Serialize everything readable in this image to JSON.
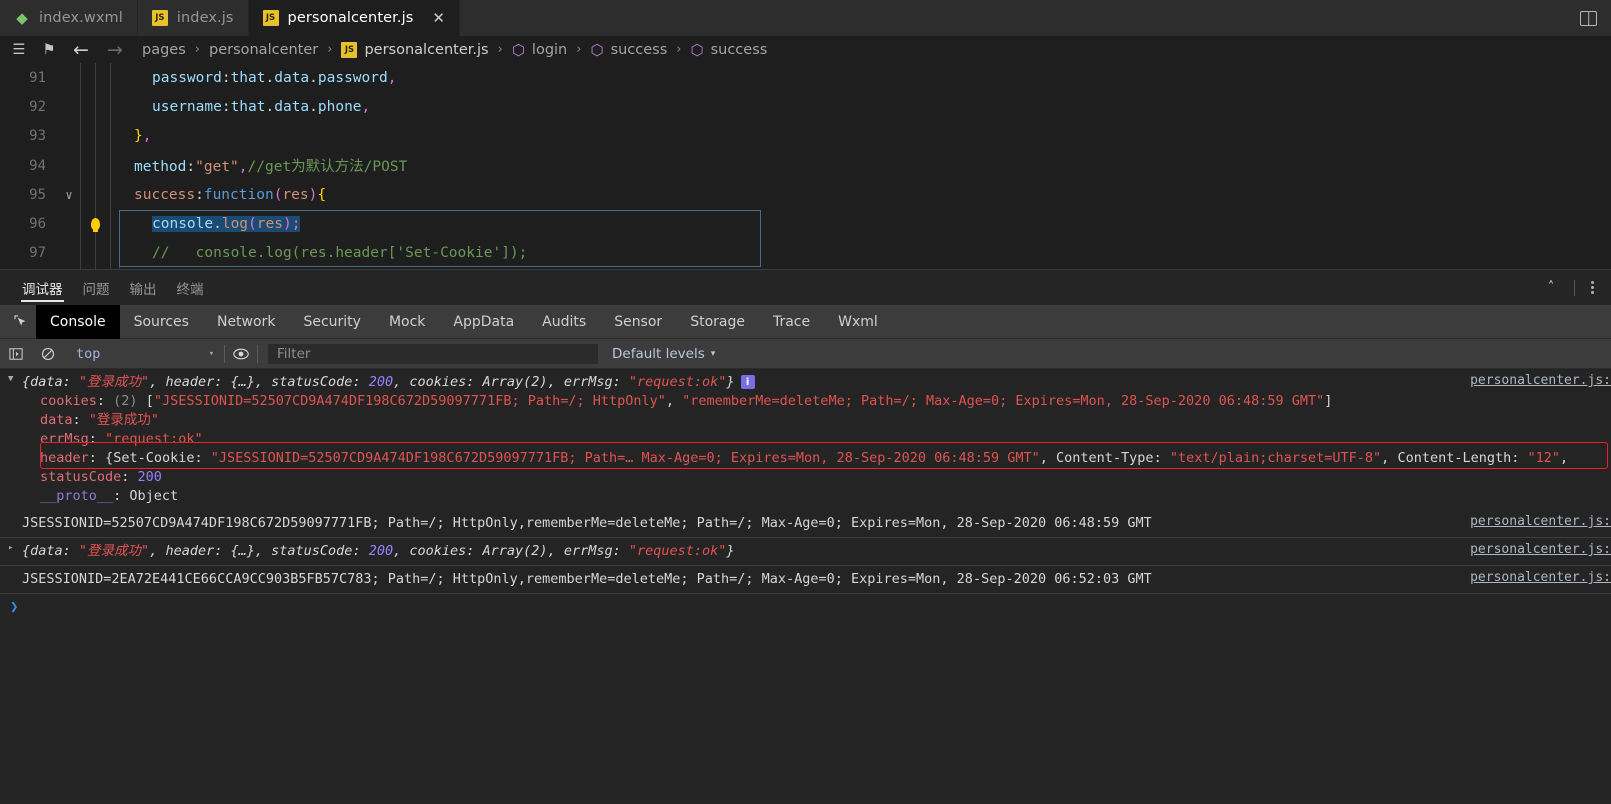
{
  "tabs": [
    {
      "label": "index.wxml",
      "icon": "wxml-file-icon",
      "icon_text": "◈",
      "active": false,
      "closable": false
    },
    {
      "label": "index.js",
      "icon": "js-file-icon",
      "icon_text": "JS",
      "active": false,
      "closable": false
    },
    {
      "label": "personalcenter.js",
      "icon": "js-file-icon",
      "icon_text": "JS",
      "active": true,
      "closable": true,
      "close_label": "✕"
    }
  ],
  "tabbar": {
    "split_editor_label": "split-editor"
  },
  "breadcrumb": {
    "menu_icon": "☰",
    "bookmark_icon": "⚑",
    "back_icon": "←",
    "forward_icon": "→",
    "segments": [
      {
        "text": "pages",
        "type": "folder"
      },
      {
        "text": "personalcenter",
        "type": "folder"
      },
      {
        "text": "personalcenter.js",
        "type": "file",
        "icon_text": "JS"
      },
      {
        "text": "login",
        "type": "symbol",
        "icon_text": "⬡"
      },
      {
        "text": "success",
        "type": "symbol",
        "icon_text": "⬡"
      },
      {
        "text": "success",
        "type": "symbol",
        "icon_text": "⬡"
      }
    ],
    "separator": "›"
  },
  "editor": {
    "lines": [
      {
        "no": "91",
        "folded": "",
        "bulb": false,
        "indent": 4,
        "tokens": [
          {
            "t": "password",
            "c": "k-prop"
          },
          {
            "t": ":",
            "c": "k-id"
          },
          {
            "t": "that",
            "c": "k-var"
          },
          {
            "t": ".",
            "c": "k-id"
          },
          {
            "t": "data",
            "c": "k-var"
          },
          {
            "t": ".",
            "c": "k-id"
          },
          {
            "t": "password",
            "c": "k-var"
          },
          {
            "t": ",",
            "c": "k-paren"
          }
        ]
      },
      {
        "no": "92",
        "folded": "",
        "bulb": false,
        "indent": 4,
        "tokens": [
          {
            "t": "username",
            "c": "k-prop"
          },
          {
            "t": ":",
            "c": "k-id"
          },
          {
            "t": "that",
            "c": "k-var"
          },
          {
            "t": ".",
            "c": "k-id"
          },
          {
            "t": "data",
            "c": "k-var"
          },
          {
            "t": ".",
            "c": "k-id"
          },
          {
            "t": "phone",
            "c": "k-var"
          },
          {
            "t": ",",
            "c": "k-paren"
          }
        ]
      },
      {
        "no": "93",
        "folded": "",
        "bulb": false,
        "indent": 2,
        "tokens": [
          {
            "t": "}",
            "c": "k-brace"
          },
          {
            "t": ",",
            "c": "k-paren"
          }
        ]
      },
      {
        "no": "94",
        "folded": "",
        "bulb": false,
        "indent": 2,
        "tokens": [
          {
            "t": "method",
            "c": "k-prop"
          },
          {
            "t": ":",
            "c": "k-id"
          },
          {
            "t": "\"get\"",
            "c": "k-str"
          },
          {
            "t": ",",
            "c": "k-paren"
          },
          {
            "t": "//get为默认方法/POST",
            "c": "k-cmt"
          }
        ]
      },
      {
        "no": "95",
        "folded": "∨",
        "bulb": false,
        "indent": 2,
        "tokens": [
          {
            "t": "success",
            "c": "k-orange"
          },
          {
            "t": ":",
            "c": "k-id"
          },
          {
            "t": "function",
            "c": "k-kw"
          },
          {
            "t": "(",
            "c": "k-paren"
          },
          {
            "t": "res",
            "c": "k-orange"
          },
          {
            "t": ")",
            "c": "k-paren"
          },
          {
            "t": "{",
            "c": "k-brace"
          }
        ]
      },
      {
        "no": "96",
        "folded": "",
        "bulb": true,
        "indent": 4,
        "tokens": [
          {
            "t": "console",
            "c": "k-console"
          },
          {
            "t": ".",
            "c": "k-id"
          },
          {
            "t": "log",
            "c": "k-orange"
          },
          {
            "t": "(",
            "c": "k-paren"
          },
          {
            "t": "res",
            "c": "k-orange"
          },
          {
            "t": ")",
            "c": "k-paren"
          },
          {
            "t": ";",
            "c": "k-paren"
          }
        ]
      },
      {
        "no": "97",
        "folded": "",
        "bulb": false,
        "indent": 4,
        "tokens": [
          {
            "t": "//   console.log(res.header['Set-Cookie']);",
            "c": "k-cmt"
          }
        ]
      }
    ]
  },
  "panel": {
    "tabs": [
      {
        "label": "调试器",
        "active": true
      },
      {
        "label": "问题",
        "active": false
      },
      {
        "label": "输出",
        "active": false
      },
      {
        "label": "终端",
        "active": false
      }
    ],
    "maximize_icon": "˄",
    "more_icon": "more-options"
  },
  "devtools": {
    "inspect_icon": "inspect-element-icon",
    "tabs": [
      {
        "label": "Console",
        "active": true
      },
      {
        "label": "Sources",
        "active": false
      },
      {
        "label": "Network",
        "active": false
      },
      {
        "label": "Security",
        "active": false
      },
      {
        "label": "Mock",
        "active": false
      },
      {
        "label": "AppData",
        "active": false
      },
      {
        "label": "Audits",
        "active": false
      },
      {
        "label": "Sensor",
        "active": false
      },
      {
        "label": "Storage",
        "active": false
      },
      {
        "label": "Trace",
        "active": false
      },
      {
        "label": "Wxml",
        "active": false
      }
    ],
    "toolbar": {
      "sidebar_toggle_icon": "console-sidebar-icon",
      "clear_icon": "clear-console-icon",
      "context_value": "top",
      "context_caret": "▾",
      "eye_icon": "live-expression-icon",
      "filter_placeholder": "Filter",
      "filter_value": "",
      "levels_label": "Default levels",
      "levels_caret": "▾"
    }
  },
  "console_output": {
    "source_link": "personalcenter.js:",
    "messages": [
      {
        "id": "msg-1",
        "type": "object-group",
        "expanded": true,
        "arrow": "▼",
        "summary_parts": [
          {
            "t": "{",
            "c": "c-prop c-ital"
          },
          {
            "t": "data",
            "c": "c-prop c-ital"
          },
          {
            "t": ": ",
            "c": "c-prop c-ital"
          },
          {
            "t": "\"登录成功\"",
            "c": "c-str c-ital"
          },
          {
            "t": ", ",
            "c": "c-prop c-ital"
          },
          {
            "t": "header",
            "c": "c-prop c-ital"
          },
          {
            "t": ": ",
            "c": "c-prop c-ital"
          },
          {
            "t": "{…}",
            "c": "c-prop c-ital"
          },
          {
            "t": ", ",
            "c": "c-prop c-ital"
          },
          {
            "t": "statusCode",
            "c": "c-prop c-ital"
          },
          {
            "t": ": ",
            "c": "c-prop c-ital"
          },
          {
            "t": "200",
            "c": "c-num c-ital"
          },
          {
            "t": ", ",
            "c": "c-prop c-ital"
          },
          {
            "t": "cookies",
            "c": "c-prop c-ital"
          },
          {
            "t": ": ",
            "c": "c-prop c-ital"
          },
          {
            "t": "Array(2)",
            "c": "c-prop c-ital"
          },
          {
            "t": ", ",
            "c": "c-prop c-ital"
          },
          {
            "t": "errMsg",
            "c": "c-prop c-ital"
          },
          {
            "t": ": ",
            "c": "c-prop c-ital"
          },
          {
            "t": "\"request:ok\"",
            "c": "c-str c-ital"
          },
          {
            "t": "}",
            "c": "c-prop c-ital"
          }
        ],
        "badge": "i",
        "children": [
          {
            "arrow": "▸",
            "parts": [
              {
                "t": "cookies",
                "c": "c-name"
              },
              {
                "t": ": ",
                "c": "c-prop"
              },
              {
                "t": "(2) ",
                "c": "c-gray"
              },
              {
                "t": "[",
                "c": "c-prop"
              },
              {
                "t": "\"JSESSIONID=52507CD9A474DF198C672D59097771FB; Path=/; HttpOnly\"",
                "c": "c-str"
              },
              {
                "t": ", ",
                "c": "c-prop"
              },
              {
                "t": "\"rememberMe=deleteMe; Path=/; Max-Age=0; Expires=Mon, 28-Sep-2020 06:48:59 GMT\"",
                "c": "c-str"
              },
              {
                "t": "]",
                "c": "c-prop"
              }
            ]
          },
          {
            "arrow": "",
            "parts": [
              {
                "t": "data",
                "c": "c-name"
              },
              {
                "t": ": ",
                "c": "c-prop"
              },
              {
                "t": "\"登录成功\"",
                "c": "c-str"
              }
            ]
          },
          {
            "arrow": "",
            "parts": [
              {
                "t": "errMsg",
                "c": "c-name"
              },
              {
                "t": ": ",
                "c": "c-prop"
              },
              {
                "t": "\"request:ok\"",
                "c": "c-str"
              }
            ]
          },
          {
            "arrow": "▸",
            "highlighted": true,
            "parts": [
              {
                "t": "header",
                "c": "c-name"
              },
              {
                "t": ": ",
                "c": "c-prop"
              },
              {
                "t": "{",
                "c": "c-prop"
              },
              {
                "t": "Set-Cookie",
                "c": "c-prop"
              },
              {
                "t": ": ",
                "c": "c-prop"
              },
              {
                "t": "\"JSESSIONID=52507CD9A474DF198C672D59097771FB; Path=… Max-Age=0; Expires=Mon, 28-Sep-2020 06:48:59 GMT\"",
                "c": "c-str"
              },
              {
                "t": ", ",
                "c": "c-prop"
              },
              {
                "t": "Content-Type",
                "c": "c-prop"
              },
              {
                "t": ": ",
                "c": "c-prop"
              },
              {
                "t": "\"text/plain;charset=UTF-8\"",
                "c": "c-str"
              },
              {
                "t": ", ",
                "c": "c-prop"
              },
              {
                "t": "Content-Length",
                "c": "c-prop"
              },
              {
                "t": ": ",
                "c": "c-prop"
              },
              {
                "t": "\"12\"",
                "c": "c-str"
              },
              {
                "t": ", ",
                "c": "c-prop"
              }
            ]
          },
          {
            "arrow": "",
            "parts": [
              {
                "t": "statusCode",
                "c": "c-name"
              },
              {
                "t": ": ",
                "c": "c-prop"
              },
              {
                "t": "200",
                "c": "c-num"
              }
            ]
          },
          {
            "arrow": "▸",
            "parts": [
              {
                "t": "__proto__",
                "c": "c-proto"
              },
              {
                "t": ": ",
                "c": "c-prop"
              },
              {
                "t": "Object",
                "c": "c-prop"
              }
            ]
          }
        ]
      },
      {
        "id": "msg-2",
        "type": "text",
        "arrow": "",
        "summary_parts": [
          {
            "t": "JSESSIONID=52507CD9A474DF198C672D59097771FB; Path=/; HttpOnly,rememberMe=deleteMe; Path=/; Max-Age=0; Expires=Mon, 28-Sep-2020 06:48:59 GMT",
            "c": "c-prop"
          }
        ]
      },
      {
        "id": "msg-3",
        "type": "object-collapsed",
        "arrow": "▸",
        "summary_parts": [
          {
            "t": "{",
            "c": "c-prop c-ital"
          },
          {
            "t": "data",
            "c": "c-prop c-ital"
          },
          {
            "t": ": ",
            "c": "c-prop c-ital"
          },
          {
            "t": "\"登录成功\"",
            "c": "c-str c-ital"
          },
          {
            "t": ", ",
            "c": "c-prop c-ital"
          },
          {
            "t": "header",
            "c": "c-prop c-ital"
          },
          {
            "t": ": ",
            "c": "c-prop c-ital"
          },
          {
            "t": "{…}",
            "c": "c-prop c-ital"
          },
          {
            "t": ", ",
            "c": "c-prop c-ital"
          },
          {
            "t": "statusCode",
            "c": "c-prop c-ital"
          },
          {
            "t": ": ",
            "c": "c-prop c-ital"
          },
          {
            "t": "200",
            "c": "c-num c-ital"
          },
          {
            "t": ", ",
            "c": "c-prop c-ital"
          },
          {
            "t": "cookies",
            "c": "c-prop c-ital"
          },
          {
            "t": ": ",
            "c": "c-prop c-ital"
          },
          {
            "t": "Array(2)",
            "c": "c-prop c-ital"
          },
          {
            "t": ", ",
            "c": "c-prop c-ital"
          },
          {
            "t": "errMsg",
            "c": "c-prop c-ital"
          },
          {
            "t": ": ",
            "c": "c-prop c-ital"
          },
          {
            "t": "\"request:ok\"",
            "c": "c-str c-ital"
          },
          {
            "t": "}",
            "c": "c-prop c-ital"
          }
        ]
      },
      {
        "id": "msg-4",
        "type": "text",
        "arrow": "",
        "summary_parts": [
          {
            "t": "JSESSIONID=2EA72E441CE66CCA9CC903B5FB57C783; Path=/; HttpOnly,rememberMe=deleteMe; Path=/; Max-Age=0; Expires=Mon, 28-Sep-2020 06:52:03 GMT",
            "c": "c-prop"
          }
        ]
      }
    ],
    "prompt": "❯"
  },
  "colors": {
    "editor_bg": "#1e1e1e",
    "tabbar_bg": "#2d2d2d",
    "panel_bg": "#252526",
    "devtools_bg": "#3c3c3c",
    "console_bg": "#242424",
    "annotation_red": "#f02020",
    "string_red": "#e05252",
    "number_purple": "#9980ff",
    "js_yellow": "#e8c02e",
    "prompt_blue": "#3b8eea"
  }
}
